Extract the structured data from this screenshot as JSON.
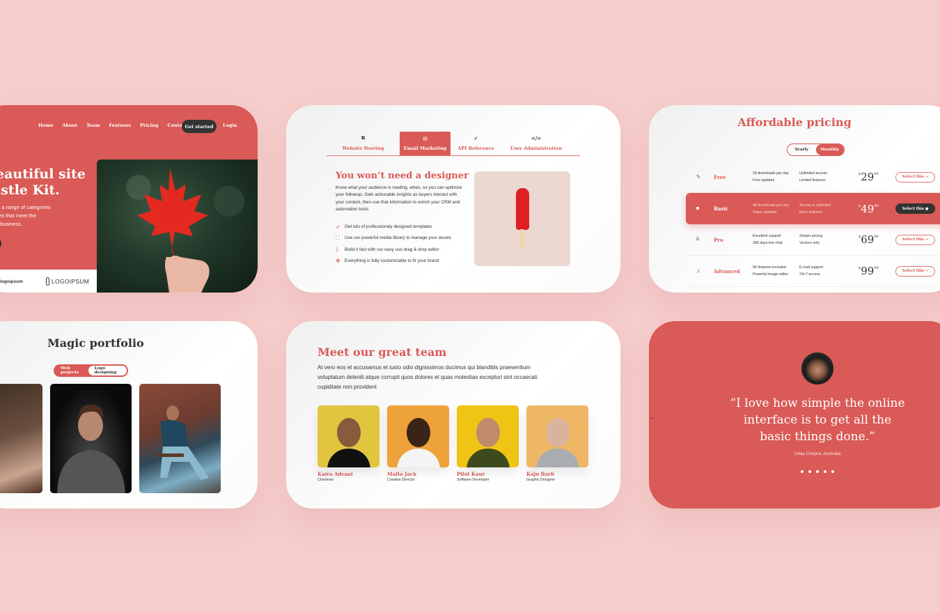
{
  "colors": {
    "background": "#f5cdcb",
    "accent": "#d95a56",
    "dark": "#333333",
    "card": "#ffffff"
  },
  "hero_card": {
    "nav": [
      "Home",
      "About",
      "Team",
      "Features",
      "Pricing",
      "Contact"
    ],
    "cta": "Get started",
    "login": "Login",
    "title_line1": "eautiful site",
    "title_line2": "istle Kit.",
    "desc_line1": "m a range of categories",
    "desc_line2": "ges that meet the",
    "desc_line3": "g business.",
    "logos": [
      "logoipsum",
      "LOGOIPSUM"
    ],
    "image": "red-maple-leaf-in-hand"
  },
  "tabs_card": {
    "tabs": [
      {
        "icon": "copy-icon",
        "glyph": "⧉",
        "label": "Website Hosting",
        "active": false
      },
      {
        "icon": "message-icon",
        "glyph": "▤",
        "label": "Email Marketing",
        "active": true
      },
      {
        "icon": "check-icon",
        "glyph": "✓",
        "label": "API Reference",
        "active": false
      },
      {
        "icon": "code-icon",
        "glyph": "</>",
        "label": "User Administration",
        "active": false
      }
    ],
    "heading": "You won’t need a designer",
    "description": "Know what your audience is reading, when, so you can optimize your followup. Gain actionable insights as buyers interact with your content, then use that information to enrich your CRM and automation tools.",
    "features": [
      {
        "icon": "send-icon",
        "glyph": "➶",
        "text": "Get lots of professionaly designed templates"
      },
      {
        "icon": "expand-icon",
        "glyph": "⛶",
        "text": "Use our powerful media library to manage your assets"
      },
      {
        "icon": "bluetooth-icon",
        "glyph": "ᛒ",
        "text": "Build it fast with our easy use drag & drop editor"
      },
      {
        "icon": "move-icon",
        "glyph": "✥",
        "text": "Everything is fully customizable to fir your brand"
      }
    ],
    "image": "red-popsicle"
  },
  "pricing_card": {
    "title": "Affordable pricing",
    "toggle": [
      {
        "label": "Yearly",
        "active": false
      },
      {
        "label": "Monthly",
        "active": true
      }
    ],
    "plans": [
      {
        "icon": "edit-icon",
        "glyph": "✎",
        "name": "Free",
        "f1a": "24 downloads per day",
        "f1b": "Free updates",
        "f2a": "Unlimited access",
        "f2b": "Limited features",
        "currency": "$",
        "price": "29",
        "cents": "99",
        "button": "Select this →",
        "highlighted": false
      },
      {
        "icon": "disc-icon",
        "glyph": "◙",
        "name": "Basic",
        "f1a": "48 downloads per day",
        "f1b": "Super updates",
        "f2a": "Access is unlimited",
        "f2b": "More features",
        "currency": "$",
        "price": "49",
        "cents": "99",
        "button": "Select this ●",
        "highlighted": true
      },
      {
        "icon": "radio-icon",
        "glyph": "⌸",
        "name": "Pro",
        "f1a": "Excellent support",
        "f1b": "365 days live chat",
        "f2a": "Simple pricing",
        "f2b": "Vectors only",
        "currency": "$",
        "price": "69",
        "cents": "99",
        "button": "Select this →",
        "highlighted": false
      },
      {
        "icon": "music-icon",
        "glyph": "♫",
        "name": "Advanced",
        "f1a": "96 features included",
        "f1b": "Powerful image editor",
        "f2a": "E-mail support",
        "f2b": "24×7 access",
        "currency": "$",
        "price": "99",
        "cents": "99",
        "button": "Select this →",
        "highlighted": false
      }
    ]
  },
  "portfolio_card": {
    "title": "Magic portfolio",
    "toggle": [
      {
        "label": "Web projects",
        "active": false
      },
      {
        "label": "Logo designing",
        "active": true
      }
    ],
    "photos": [
      "woman-with-tattoo",
      "man-in-dark-sweater",
      "man-sitting-on-chair"
    ]
  },
  "team_card": {
    "title": "Meet our great team",
    "description": "At vero eos et accusamus et iusto odio dignissimos ducimus qui blanditiis praesentium voluptatum deleniti atque corrupti quos dolores et quas molestias excepturi sint occaecati cupiditate non provident",
    "members": [
      {
        "name": "Kaira Advani",
        "role": "Chariman",
        "bg": "#e3c43f",
        "shirt": "#111111"
      },
      {
        "name": "Malta Jack",
        "role": "Creative Director",
        "bg": "#eea23a",
        "shirt": "#f4f4f4"
      },
      {
        "name": "Pilot Kaur",
        "role": "Software Developer",
        "bg": "#f0c414",
        "shirt": "#3d4a1e"
      },
      {
        "name": "Kaju Barfi",
        "role": "Graphic Designer",
        "bg": "#eeb765",
        "shirt": "#a9adb2"
      }
    ]
  },
  "testimonial_card": {
    "quote_line1": "“I love how simple the online",
    "quote_line2": "interface is to get all the",
    "quote_line3": "basic things done.”",
    "author": "Uday Chopra, Australia",
    "dots": 5,
    "prev_arrow": "←"
  }
}
